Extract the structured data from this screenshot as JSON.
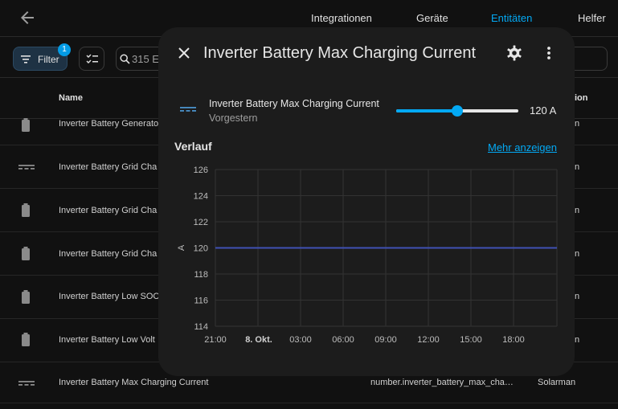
{
  "header": {
    "tabs": [
      {
        "label": "Integrationen"
      },
      {
        "label": "Geräte"
      },
      {
        "label": "Entitäten"
      },
      {
        "label": "Helfer"
      }
    ],
    "active_tab": "Entitäten"
  },
  "toolbar": {
    "filter_label": "Filter",
    "filter_count": "1",
    "search_text": "315 En"
  },
  "table": {
    "columns": {
      "name": "Name",
      "integration_partial": "ion"
    },
    "rows": [
      {
        "icon": "battery-icon",
        "name": "Inverter Battery Generato",
        "entity": "",
        "integration": "n"
      },
      {
        "icon": "current-dc-icon",
        "name": "Inverter Battery Grid Cha",
        "entity": "",
        "integration": "n"
      },
      {
        "icon": "battery-icon",
        "name": "Inverter Battery Grid Cha",
        "entity": "",
        "integration": "n"
      },
      {
        "icon": "battery-icon",
        "name": "Inverter Battery Grid Cha",
        "entity": "",
        "integration": "n"
      },
      {
        "icon": "battery-icon",
        "name": "Inverter Battery Low SOC",
        "entity": "",
        "integration": "n"
      },
      {
        "icon": "battery-icon",
        "name": "Inverter Battery Low Volt",
        "entity": "",
        "integration": "n"
      },
      {
        "icon": "current-dc-icon",
        "name": "Inverter Battery Max Charging Current",
        "entity": "number.inverter_battery_max_cha…",
        "integration": "Solarman"
      }
    ]
  },
  "dialog": {
    "title": "Inverter Battery Max Charging Current",
    "entity_name": "Inverter Battery Max Charging Current",
    "last_changed": "Vorgestern",
    "value_text": "120 A",
    "slider_fraction": 0.5,
    "history_title": "Verlauf",
    "show_more": "Mehr anzeigen"
  },
  "colors": {
    "accent": "#03a9f4",
    "series": "#3f51b5",
    "background": "#111111",
    "dialog": "#1c1c1c"
  },
  "chart_data": {
    "type": "line",
    "ylabel": "A",
    "ylim": [
      114,
      126
    ],
    "yticks": [
      114,
      116,
      118,
      120,
      122,
      124,
      126
    ],
    "xticks": [
      {
        "label": "21:00",
        "bold": false
      },
      {
        "label": "8. Okt.",
        "bold": true
      },
      {
        "label": "03:00",
        "bold": false
      },
      {
        "label": "06:00",
        "bold": false
      },
      {
        "label": "09:00",
        "bold": false
      },
      {
        "label": "12:00",
        "bold": false
      },
      {
        "label": "15:00",
        "bold": false
      },
      {
        "label": "18:00",
        "bold": false
      }
    ],
    "series": [
      {
        "values": [
          120,
          120,
          120,
          120,
          120,
          120,
          120,
          120,
          120
        ]
      }
    ],
    "grid": true
  }
}
